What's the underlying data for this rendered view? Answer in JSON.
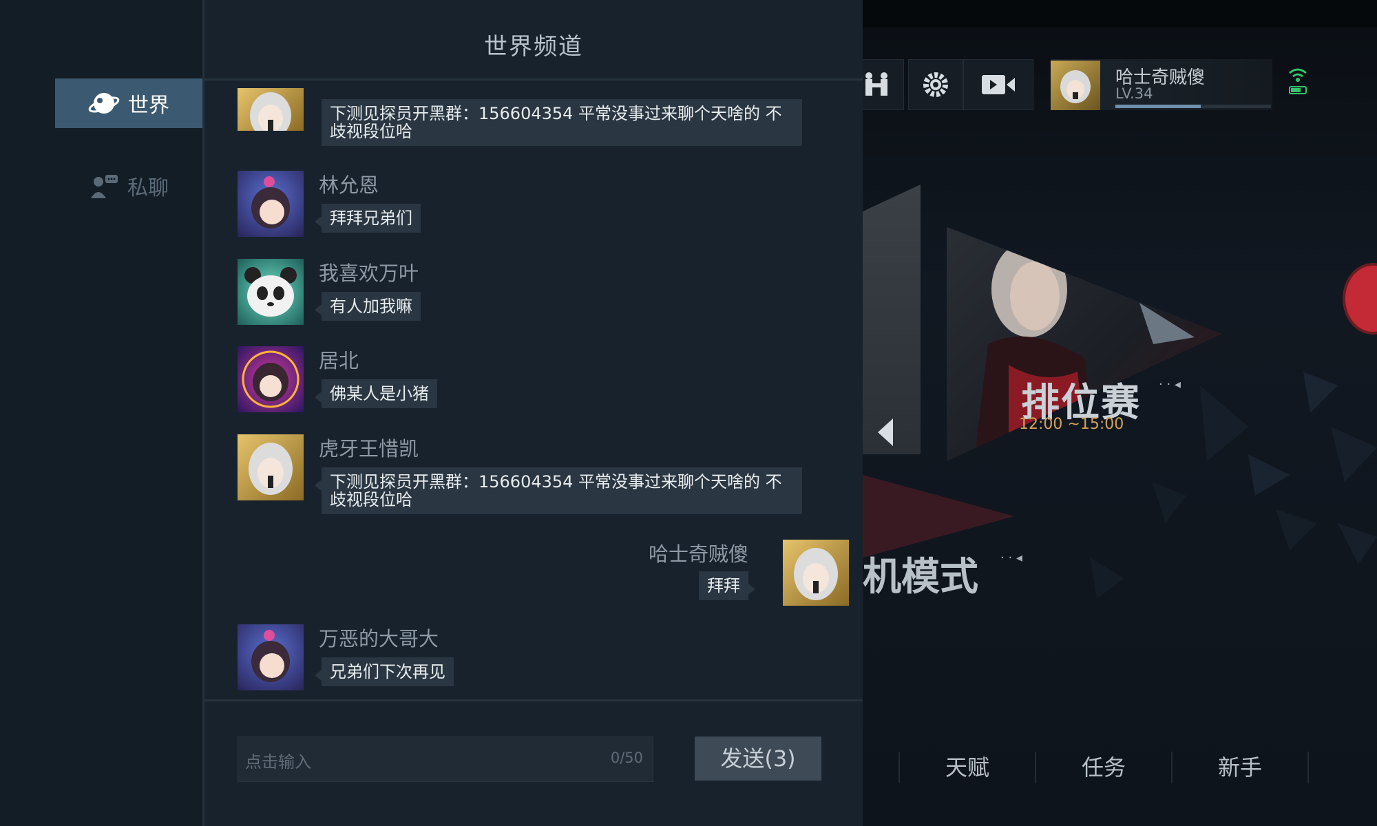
{
  "nav": {
    "world_label": "世界",
    "private_label": "私聊"
  },
  "chat": {
    "title": "世界频道",
    "messages": [
      {
        "name": "",
        "text": "下测见探员开黑群：156604354 平常没事过来聊个天啥的 不歧视段位哈",
        "avatar": "gold-hood-avatar"
      },
      {
        "name": "林允恩",
        "text": "拜拜兄弟们",
        "avatar": "purple-girl-avatar"
      },
      {
        "name": "我喜欢万叶",
        "text": "有人加我嘛",
        "avatar": "panda-avatar"
      },
      {
        "name": "居北",
        "text": "佛某人是小猪",
        "avatar": "neon-girl-avatar"
      },
      {
        "name": "虎牙王惜凯",
        "text": "下测见探员开黑群：156604354 平常没事过来聊个天啥的 不歧视段位哈",
        "avatar": "gold-hood-avatar"
      },
      {
        "name": "哈士奇贼傻",
        "text": "拜拜",
        "avatar": "gold-hood-avatar",
        "self": true
      },
      {
        "name": "万恶的大哥大",
        "text": "兄弟们下次再见",
        "avatar": "purple-girl-avatar"
      }
    ]
  },
  "input": {
    "placeholder": "点击输入",
    "counter": "0/50",
    "send_label": "发送(3)"
  },
  "game": {
    "player_name": "哈士奇贼傻",
    "player_level": "LV.34",
    "xp_progress": 0.55,
    "rank_mode_title": "排位赛",
    "rank_mode_time": "12:00 ~15:00",
    "other_mode_title": "机模式",
    "mode_dots": "· · ◂",
    "bottom_tabs": [
      "天赋",
      "任务",
      "新手"
    ]
  },
  "colors": {
    "nav_active": "#3b5a71",
    "bubble": "#2a3641",
    "rank_time": "#d4a257"
  }
}
